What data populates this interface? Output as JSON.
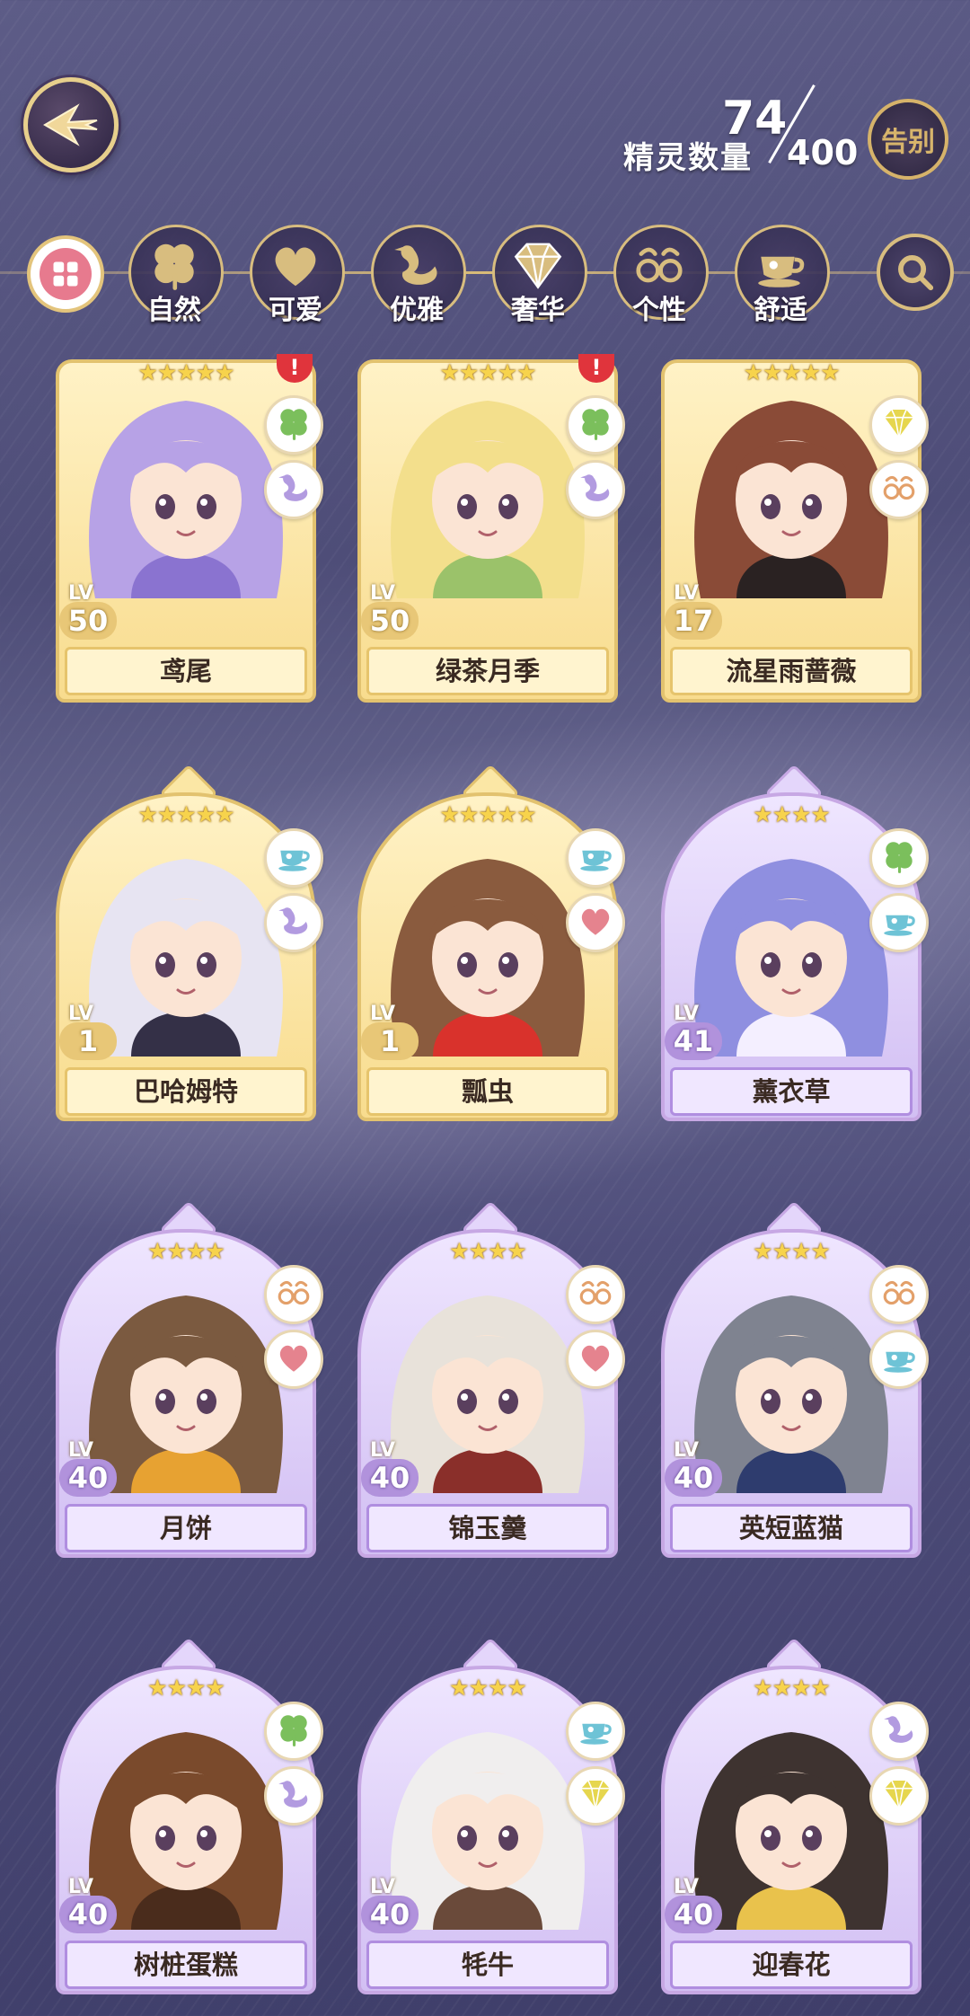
{
  "header": {
    "count_label": "精灵数量",
    "count_current": "74",
    "count_max": "400",
    "farewell_label": "告别"
  },
  "categories": [
    {
      "label": "自然",
      "icon": "clover-icon"
    },
    {
      "label": "可爱",
      "icon": "heart-icon"
    },
    {
      "label": "优雅",
      "icon": "swan-icon"
    },
    {
      "label": "奢华",
      "icon": "diamond-icon"
    },
    {
      "label": "个性",
      "icon": "glasses-icon"
    },
    {
      "label": "舒适",
      "icon": "teacup-icon"
    }
  ],
  "stars_text": {
    "five": "★★★★★",
    "four": "★★★★"
  },
  "alert_text": "!",
  "lv_label": "LV",
  "cards": [
    {
      "name": "鸢尾",
      "level": "50",
      "stars": 5,
      "tags": [
        "clover-icon",
        "swan-icon"
      ],
      "alert": true,
      "theme": "gold",
      "hair": "#b7a2e6",
      "accent": "#8a73d0"
    },
    {
      "name": "绿茶月季",
      "level": "50",
      "stars": 5,
      "tags": [
        "clover-icon",
        "swan-icon"
      ],
      "alert": true,
      "theme": "gold",
      "hair": "#f3df8c",
      "accent": "#9bc26a"
    },
    {
      "name": "流星雨蔷薇",
      "level": "17",
      "stars": 5,
      "tags": [
        "diamond-icon",
        "glasses-icon"
      ],
      "alert": false,
      "theme": "gold",
      "hair": "#8a4b37",
      "accent": "#2a2222"
    },
    {
      "name": "巴哈姆特",
      "level": "1",
      "stars": 5,
      "tags": [
        "teacup-icon",
        "swan-icon"
      ],
      "alert": false,
      "theme": "gold",
      "hair": "#e7e4f2",
      "accent": "#343047"
    },
    {
      "name": "瓢虫",
      "level": "1",
      "stars": 5,
      "tags": [
        "teacup-icon",
        "heart-icon"
      ],
      "alert": false,
      "theme": "gold",
      "hair": "#8a5b3e",
      "accent": "#d9322c"
    },
    {
      "name": "薰衣草",
      "level": "41",
      "stars": 4,
      "tags": [
        "clover-icon",
        "teacup-icon"
      ],
      "alert": false,
      "theme": "purple",
      "hair": "#8f8fe0",
      "accent": "#f4efff"
    },
    {
      "name": "月饼",
      "level": "40",
      "stars": 4,
      "tags": [
        "glasses-icon",
        "heart-icon"
      ],
      "alert": false,
      "theme": "purple",
      "hair": "#7b5a40",
      "accent": "#e7a232"
    },
    {
      "name": "锦玉羹",
      "level": "40",
      "stars": 4,
      "tags": [
        "glasses-icon",
        "heart-icon"
      ],
      "alert": false,
      "theme": "purple",
      "hair": "#e8e2da",
      "accent": "#8a2f2a"
    },
    {
      "name": "英短蓝猫",
      "level": "40",
      "stars": 4,
      "tags": [
        "glasses-icon",
        "teacup-icon"
      ],
      "alert": false,
      "theme": "purple",
      "hair": "#7f8390",
      "accent": "#2e3c6e"
    },
    {
      "name": "树桩蛋糕",
      "level": "40",
      "stars": 4,
      "tags": [
        "clover-icon",
        "swan-icon"
      ],
      "alert": false,
      "theme": "purple",
      "hair": "#7a4a2c",
      "accent": "#4a2c1c"
    },
    {
      "name": "牦牛",
      "level": "40",
      "stars": 4,
      "tags": [
        "teacup-icon",
        "diamond-icon"
      ],
      "alert": false,
      "theme": "purple",
      "hair": "#f0eeee",
      "accent": "#6a4a3a"
    },
    {
      "name": "迎春花",
      "level": "40",
      "stars": 4,
      "tags": [
        "swan-icon",
        "diamond-icon"
      ],
      "alert": false,
      "theme": "purple",
      "hair": "#3e3330",
      "accent": "#e9c24c"
    }
  ]
}
